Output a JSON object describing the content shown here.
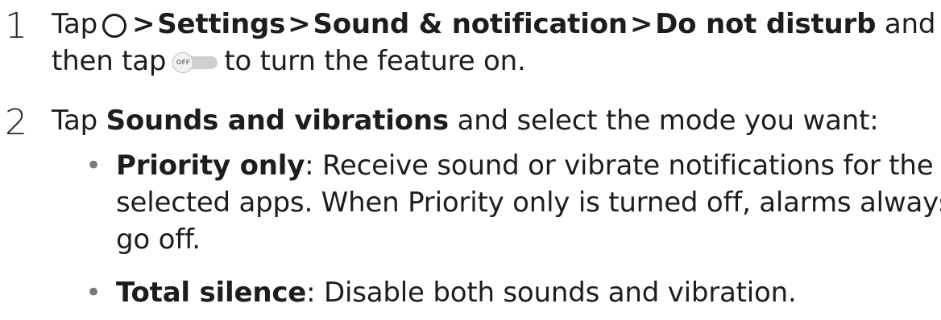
{
  "steps": [
    {
      "number": "1",
      "tap_prefix": "Tap",
      "separator": ">",
      "path": [
        "Settings",
        "Sound & notification",
        "Do not disturb"
      ],
      "and_text": "and",
      "line2_prefix": "then tap",
      "toggle_label": "OFF",
      "line2_suffix": "to turn the feature on."
    },
    {
      "number": "2",
      "tap_prefix": "Tap",
      "bold_text": "Sounds and vibrations",
      "rest_text": "and select the mode you want:",
      "bullets": [
        {
          "term": "Priority only",
          "lines": [
            ": Receive sound or vibrate notifications for the",
            "selected apps. When Priority only is turned off, alarms always",
            "go off."
          ]
        },
        {
          "term": "Total silence",
          "lines": [
            ": Disable both sounds and vibration."
          ]
        }
      ]
    }
  ],
  "bullet_glyph": "•",
  "icons": {
    "home_button": "circle-home-icon",
    "toggle": "toggle-off-icon"
  }
}
